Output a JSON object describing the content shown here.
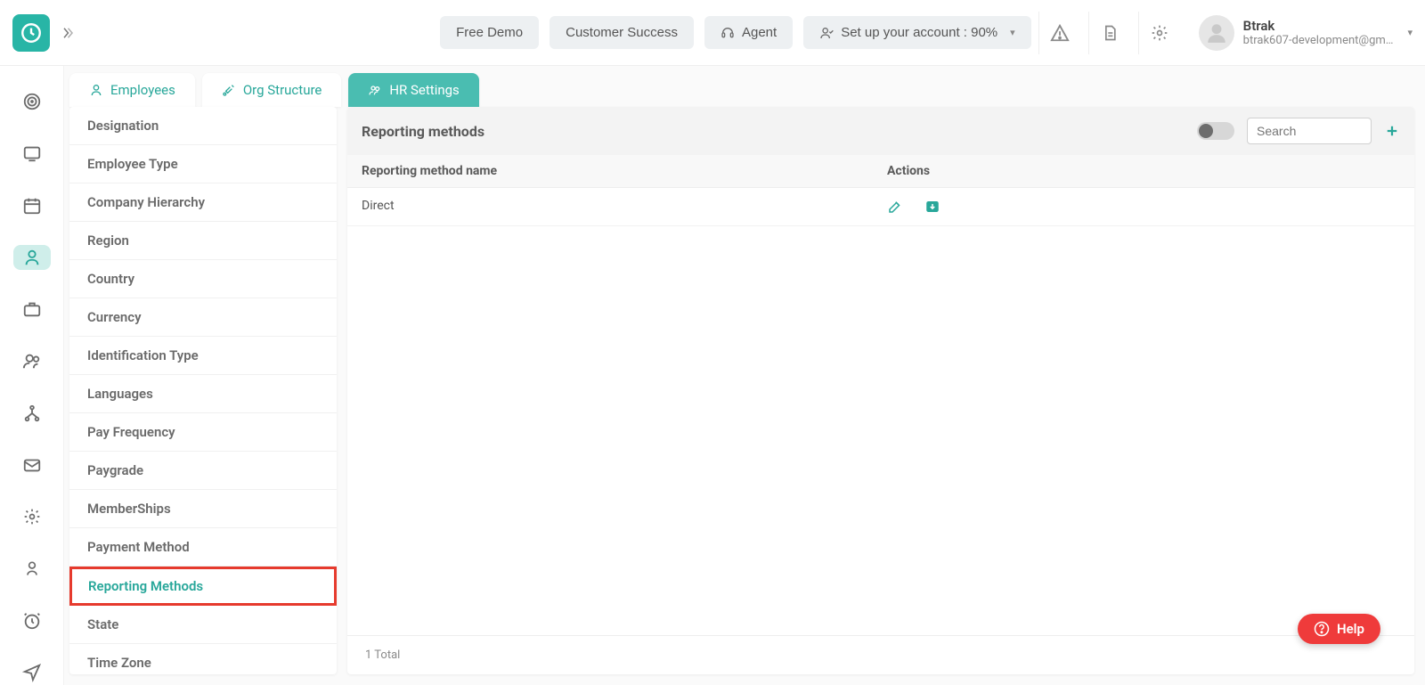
{
  "header": {
    "buttons": {
      "free_demo": "Free Demo",
      "customer_success": "Customer Success",
      "agent": "Agent",
      "setup": "Set up your account : 90%"
    },
    "user": {
      "name": "Btrak",
      "email": "btrak607-development@gm…"
    }
  },
  "tabs": [
    {
      "label": "Employees",
      "active": false
    },
    {
      "label": "Org Structure",
      "active": false
    },
    {
      "label": "HR Settings",
      "active": true
    }
  ],
  "settings_items": [
    "Designation",
    "Employee Type",
    "Company Hierarchy",
    "Region",
    "Country",
    "Currency",
    "Identification Type",
    "Languages",
    "Pay Frequency",
    "Paygrade",
    "MemberShips",
    "Payment Method",
    "Reporting Methods",
    "State",
    "Time Zone"
  ],
  "settings_selected_index": 12,
  "panel": {
    "title": "Reporting methods",
    "search_placeholder": "Search",
    "columns": {
      "name": "Reporting method name",
      "actions": "Actions"
    },
    "rows": [
      {
        "name": "Direct"
      }
    ],
    "footer": "1 Total"
  },
  "help_label": "Help"
}
